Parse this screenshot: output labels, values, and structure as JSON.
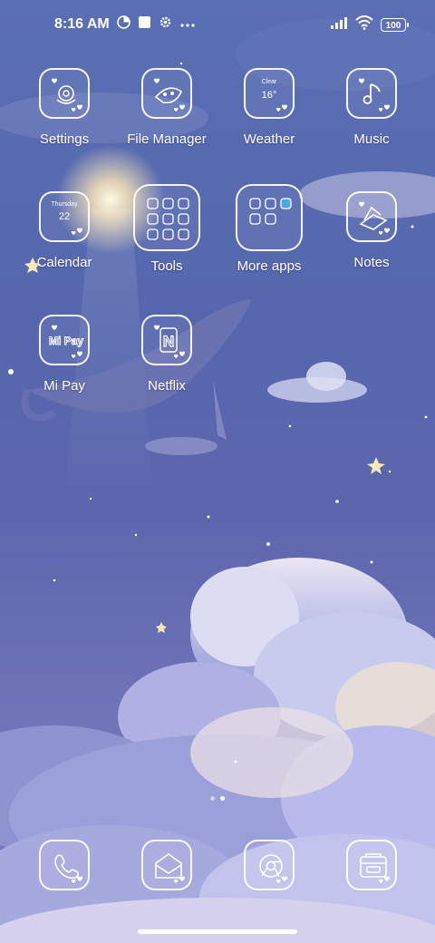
{
  "status": {
    "time": "8:16 AM",
    "battery": "100"
  },
  "apps": {
    "settings": "Settings",
    "file_manager": "File Manager",
    "weather": "Weather",
    "music": "Music",
    "calendar": "Calendar",
    "tools": "Tools",
    "more_apps": "More apps",
    "notes": "Notes",
    "mi_pay": "Mi Pay",
    "netflix": "Netflix"
  },
  "widgets": {
    "weather_condition": "Clear",
    "weather_temp": "16°",
    "calendar_weekday": "Thursday",
    "calendar_day": "22"
  },
  "icon_text": {
    "mi_pay": "Mi Pay",
    "netflix": "N"
  },
  "colors": {
    "wallpaper_top": "#5b6fb4",
    "wallpaper_bottom": "#7a7fbf",
    "icon_outline": "#ffffff"
  }
}
